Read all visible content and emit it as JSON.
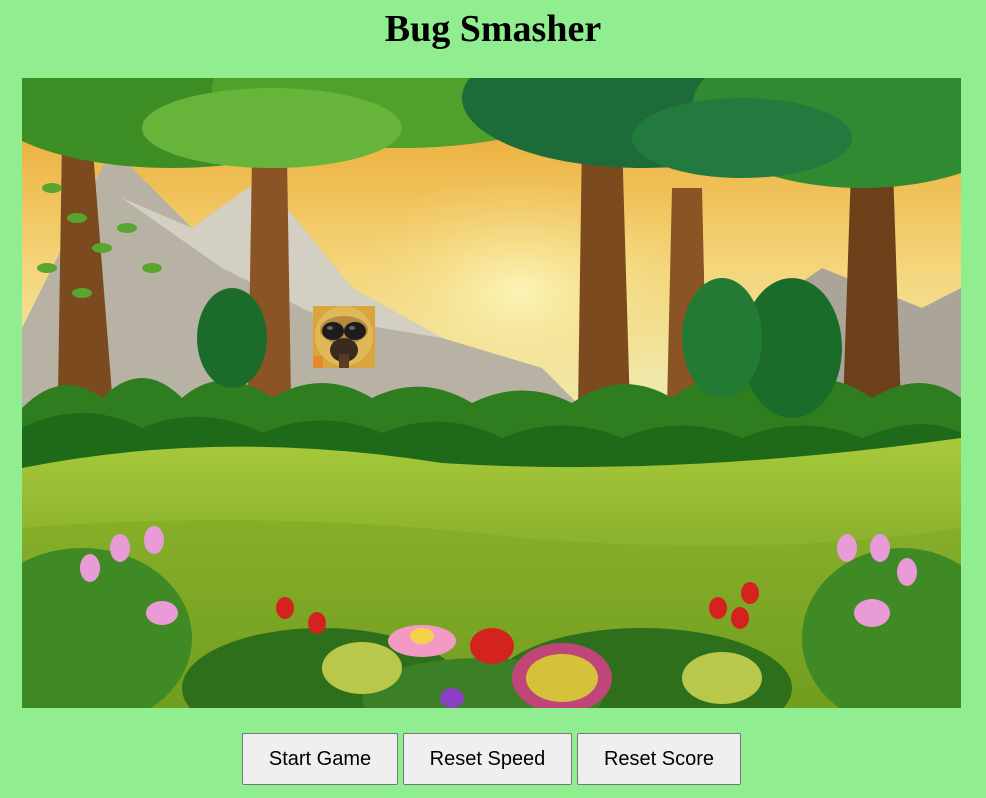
{
  "title": "Bug Smasher",
  "buttons": {
    "start": "Start Game",
    "reset_speed": "Reset Speed",
    "reset_score": "Reset Score"
  },
  "colors": {
    "page_background": "#90ee90",
    "button_background": "#efefef"
  },
  "icons": {
    "bug": "bug-icon"
  }
}
